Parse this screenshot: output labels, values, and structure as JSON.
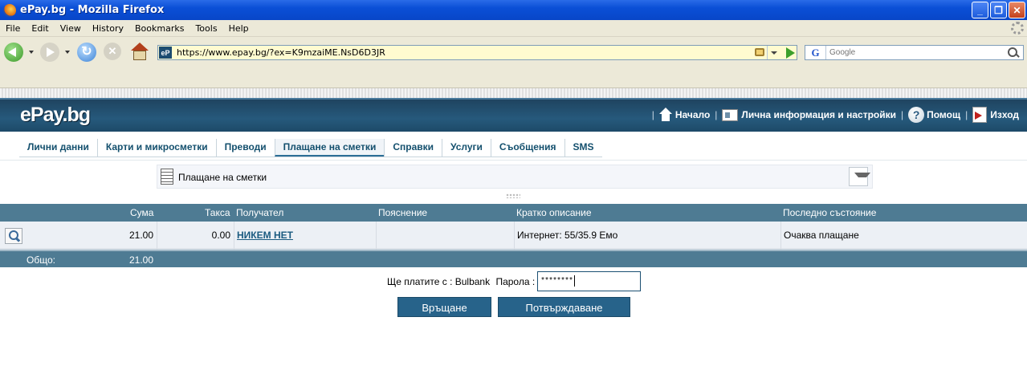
{
  "browser": {
    "window_title": "ePay.bg - Mozilla Firefox",
    "menu": [
      "File",
      "Edit",
      "View",
      "History",
      "Bookmarks",
      "Tools",
      "Help"
    ],
    "url": "https://www.epay.bg/?ex=K9mzaiME.NsD6D3JR",
    "site_icon_text": "eP",
    "search_engine_letter": "G",
    "search_placeholder": "Google",
    "window_buttons": {
      "minimize": "_",
      "maximize": "❐",
      "close": "✕"
    }
  },
  "site": {
    "logo": "ePay.bg",
    "top_links": {
      "home": "Начало",
      "profile": "Лична информация и настройки",
      "help": "Помощ",
      "logout": "Изход"
    },
    "separator": "|",
    "tabs": [
      {
        "label": "Лични данни",
        "active": false
      },
      {
        "label": "Карти и микросметки",
        "active": false
      },
      {
        "label": "Преводи",
        "active": false
      },
      {
        "label": "Плащане на сметки",
        "active": true
      },
      {
        "label": "Справки",
        "active": false
      },
      {
        "label": "Услуги",
        "active": false
      },
      {
        "label": "Съобщения",
        "active": false
      },
      {
        "label": "SMS",
        "active": false
      }
    ]
  },
  "page": {
    "section_title": "Плащане на сметки",
    "table": {
      "headers": {
        "amount": "Сума",
        "fee": "Такса",
        "recipient": "Получател",
        "explanation": "Пояснение",
        "description": "Кратко описание",
        "status": "Последно състояние"
      },
      "rows": [
        {
          "amount": "21.00",
          "fee": "0.00",
          "recipient": "НИКЕМ НЕТ",
          "explanation": "",
          "description": "Интернет: 55/35.9 Емо",
          "status": "Очаква плащане"
        }
      ],
      "total_label": "Общо:",
      "total_amount": "21.00"
    },
    "payment": {
      "pay_with_text": "Ще платите с : Bulbank",
      "password_label": "Парола :",
      "password_value": "********",
      "back_button": "Връщане",
      "confirm_button": "Потвърждаване"
    }
  },
  "colors": {
    "header_bg": "#26597c",
    "table_header_bg": "#4e7b93",
    "button_bg": "#27638a",
    "tab_text": "#14506e"
  }
}
